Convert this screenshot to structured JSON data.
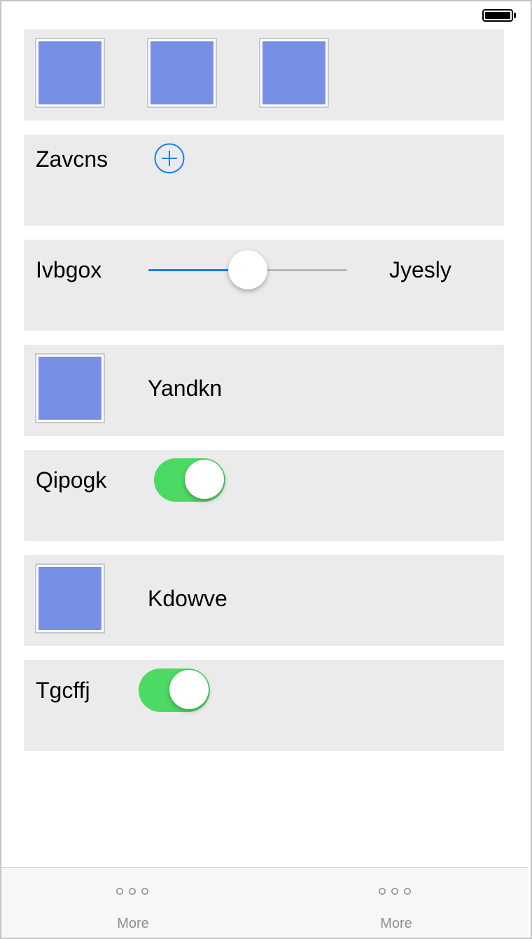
{
  "status_bar": {
    "battery_icon": "battery-full-icon"
  },
  "rows": {
    "zavcns": {
      "label": "Zavcns",
      "icon": "plus-circle-icon",
      "accent": "#1a7ef0"
    },
    "slider": {
      "left_label": "Ivbgox",
      "right_label": "Jyesly",
      "value": 0.5,
      "fill_color": "#1a7ef0"
    },
    "yandkn": {
      "label": "Yandkn"
    },
    "qipogk": {
      "label": "Qipogk",
      "on": true,
      "toggle_color": "#4cd964"
    },
    "kdowve": {
      "label": "Kdowve"
    },
    "tgcffj": {
      "label": "Tgcffj",
      "on": true,
      "toggle_color": "#4cd964"
    }
  },
  "image_placeholder_color": "#7790e6",
  "tab_bar": {
    "tabs": [
      {
        "label": "More",
        "icon": "more-dots-icon"
      },
      {
        "label": "More",
        "icon": "more-dots-icon"
      }
    ]
  }
}
